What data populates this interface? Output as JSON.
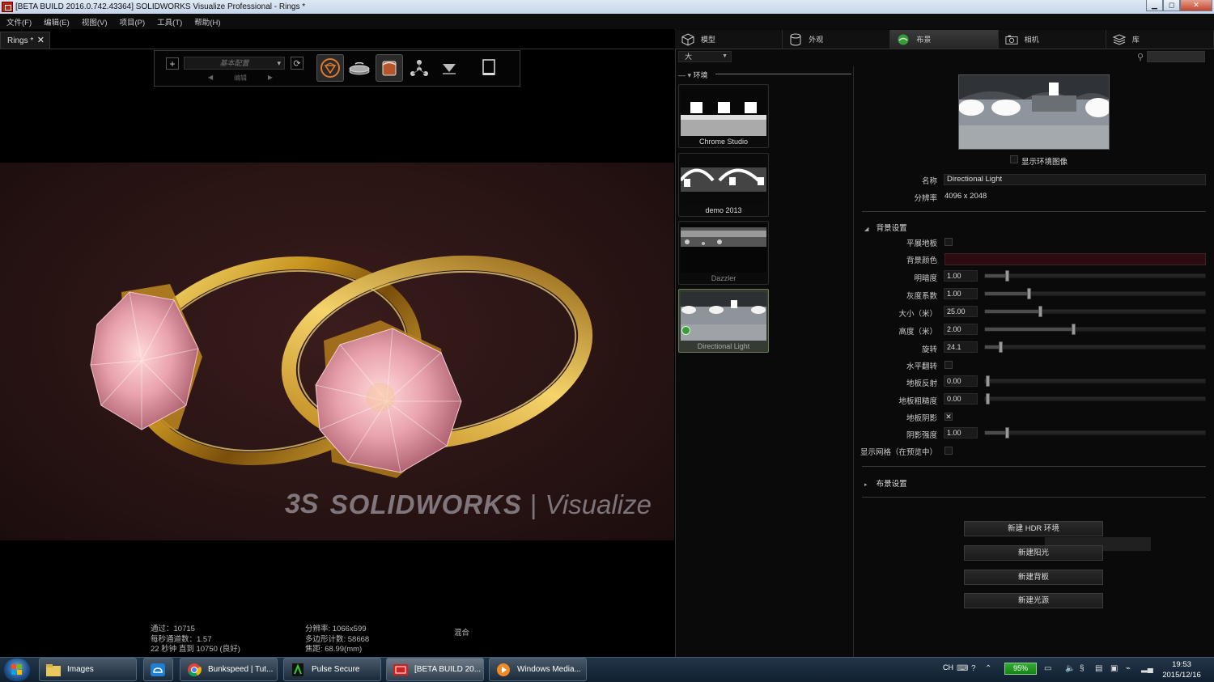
{
  "window": {
    "title": "[BETA BUILD 2016.0.742.43364] SOLIDWORKS Visualize Professional - Rings *",
    "min": "▁",
    "max": "◻",
    "close": "✕"
  },
  "menu": [
    "文件(F)",
    "编辑(E)",
    "视图(V)",
    "项目(P)",
    "工具(T)",
    "帮助(H)"
  ],
  "doc_tab": {
    "label": "Rings *",
    "close": "✕"
  },
  "toolbar": {
    "add": "+",
    "config": "基本配置",
    "edit": "编辑",
    "prev": "◀",
    "next": "▶"
  },
  "watermark": {
    "brand": "SOLIDWORKS",
    "separator": "|",
    "product": "Visualize"
  },
  "status": {
    "col1": [
      "通过：10715",
      "每秒通道数：1.57",
      "22 秒钟 直到 10750 (良好)"
    ],
    "col2": [
      "分辨率: 1066x599",
      "多边形计数: 58668",
      "焦距: 68.99(mm)"
    ],
    "col3": "混合"
  },
  "tabs": [
    {
      "label": "模型",
      "icon": "cube-icon"
    },
    {
      "label": "外观",
      "icon": "cylinder-icon"
    },
    {
      "label": "布景",
      "icon": "scene-icon",
      "active": true
    },
    {
      "label": "相机",
      "icon": "camera-icon"
    },
    {
      "label": "库",
      "icon": "library-icon"
    }
  ],
  "size_select": "大",
  "environment": {
    "heading": "环境",
    "items": [
      "Chrome Studio",
      "demo 2013",
      "Dazzler",
      "Directional Light"
    ]
  },
  "props": {
    "show_env_image": "显示环境图像",
    "name_label": "名称",
    "name_value": "Directional Light",
    "res_label": "分辨率",
    "res_value": "4096 x 2048",
    "bg_section": "背景设置",
    "flat_floor": "平展地板",
    "bg_color_label": "背景颜色",
    "bg_color": "#2d0c10",
    "brightness": {
      "label": "明暗度",
      "value": "1.00"
    },
    "gamma": {
      "label": "灰度系数",
      "value": "1.00"
    },
    "size": {
      "label": "大小（米）",
      "value": "25.00"
    },
    "height": {
      "label": "高度（米）",
      "value": "2.00"
    },
    "rotation": {
      "label": "旋转",
      "value": "24.1"
    },
    "hflip": "水平翻转",
    "floor_reflect": {
      "label": "地板反射",
      "value": "0.00"
    },
    "floor_rough": {
      "label": "地板粗糙度",
      "value": "0.00"
    },
    "floor_shadow": "地板阴影",
    "shadow_strength": {
      "label": "阴影强度",
      "value": "1.00"
    },
    "show_grid": "显示网格（在预览中）",
    "layout_section": "布景设置"
  },
  "buttons": [
    "新建 HDR 环境",
    "新建阳光",
    "新建背板",
    "新建光源"
  ],
  "taskbar": {
    "items": [
      "Images",
      "",
      "Bunkspeed | Tut...",
      "Pulse Secure",
      "[BETA BUILD 20...",
      "Windows Media..."
    ],
    "lang": "CH",
    "battery": "95%",
    "time": "19:53",
    "date": "2015/12/16"
  },
  "colors": {
    "accent_tab": "#2e2e2e",
    "scene_green": "#4caf50",
    "gold": "#c9a12a",
    "gem_pink": "#e8a7b0"
  }
}
